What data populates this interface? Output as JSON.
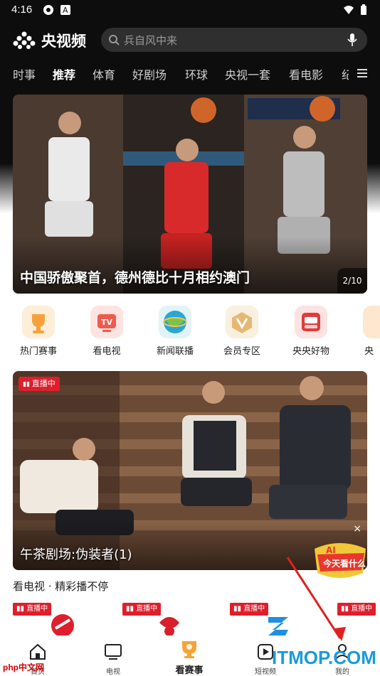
{
  "status": {
    "time": "4:16"
  },
  "header": {
    "app_name": "央视频",
    "search_placeholder": "兵自风中来"
  },
  "tabs": [
    "时事",
    "推荐",
    "体育",
    "好剧场",
    "环球",
    "央视一套",
    "看电影",
    "纪"
  ],
  "hero": {
    "caption": "中国骄傲聚首，德州德比十月相约澳门",
    "page": "2/10"
  },
  "quick_items": [
    {
      "label": "热门赛事",
      "color": "#f6a23a"
    },
    {
      "label": "看电视",
      "color": "#ef5a4f"
    },
    {
      "label": "新闻联播",
      "color": "#2aa6d6"
    },
    {
      "label": "会员专区",
      "color": "#e6b873"
    },
    {
      "label": "央央好物",
      "color": "#e23a3a"
    },
    {
      "label": "央",
      "color": "#f2a03c"
    }
  ],
  "live": {
    "badge": "直播中",
    "title": "午茶剧场:伪装者(1)",
    "close": "×"
  },
  "section": {
    "title": "看电视 · 精彩播不停"
  },
  "channels": [
    {
      "badge": "直播中"
    },
    {
      "badge": "直播中"
    },
    {
      "badge": "直播中"
    },
    {
      "badge": "直播中"
    }
  ],
  "bottom_nav": [
    {
      "label": "首页",
      "icon": "home-icon"
    },
    {
      "label": "电视",
      "icon": "tv-icon"
    },
    {
      "label": "看赛事",
      "icon": "trophy-icon"
    },
    {
      "label": "短视频",
      "icon": "play-icon"
    },
    {
      "label": "我的",
      "icon": "user-icon"
    }
  ],
  "watermarks": {
    "left": "php中文网",
    "right": "ITMOP.COM"
  }
}
